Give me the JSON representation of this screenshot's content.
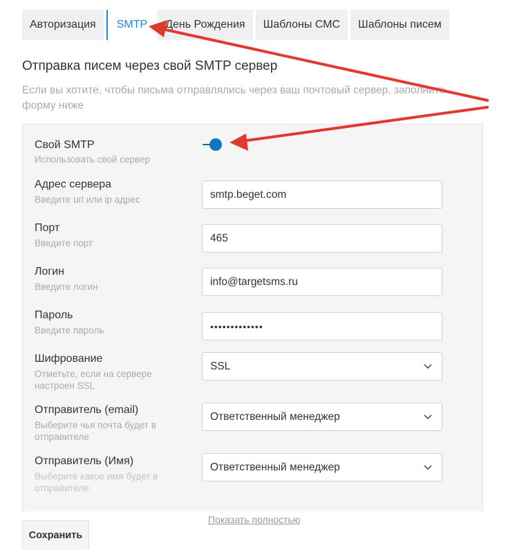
{
  "tabs": [
    {
      "label": "Авторизация",
      "active": false
    },
    {
      "label": "SMTP",
      "active": true
    },
    {
      "label": "День Рождения",
      "active": false
    },
    {
      "label": "Шаблоны СМС",
      "active": false
    },
    {
      "label": "Шаблоны писем",
      "active": false
    }
  ],
  "page": {
    "title": "Отправка писем через свой SMTP сервер",
    "description": "Если вы хотите, чтобы письма отправлялись через ваш почтовый сервер, заполните форму ниже"
  },
  "form": {
    "smtp_toggle": {
      "label": "Свой SMTP",
      "hint": "Использовать свой сервер",
      "enabled": true
    },
    "server": {
      "label": "Адрес сервера",
      "hint": "Введите url или ip адрес",
      "value": "smtp.beget.com"
    },
    "port": {
      "label": "Порт",
      "hint": "Введите порт",
      "value": "465"
    },
    "login": {
      "label": "Логин",
      "hint": "Введите логин",
      "value": "info@targetsms.ru"
    },
    "password": {
      "label": "Пароль",
      "hint": "Введите пароль",
      "value": "•••••••••••••"
    },
    "encryption": {
      "label": "Шифрование",
      "hint": "Отметьте, если на сервере настроен SSL",
      "value": "SSL"
    },
    "sender_email": {
      "label": "Отправитель (email)",
      "hint": "Выберите чья почта будет в отправителе",
      "value": "Ответственный менеджер"
    },
    "sender_name": {
      "label": "Отправитель (Имя)",
      "hint": "Выберите какое имя будет в отправителе",
      "value": "Ответственный менеджер"
    }
  },
  "actions": {
    "show_more": "Показать полностью",
    "save": "Сохранить"
  },
  "colors": {
    "accent": "#1c8ad1",
    "annotation_arrow": "#e03a2f"
  }
}
